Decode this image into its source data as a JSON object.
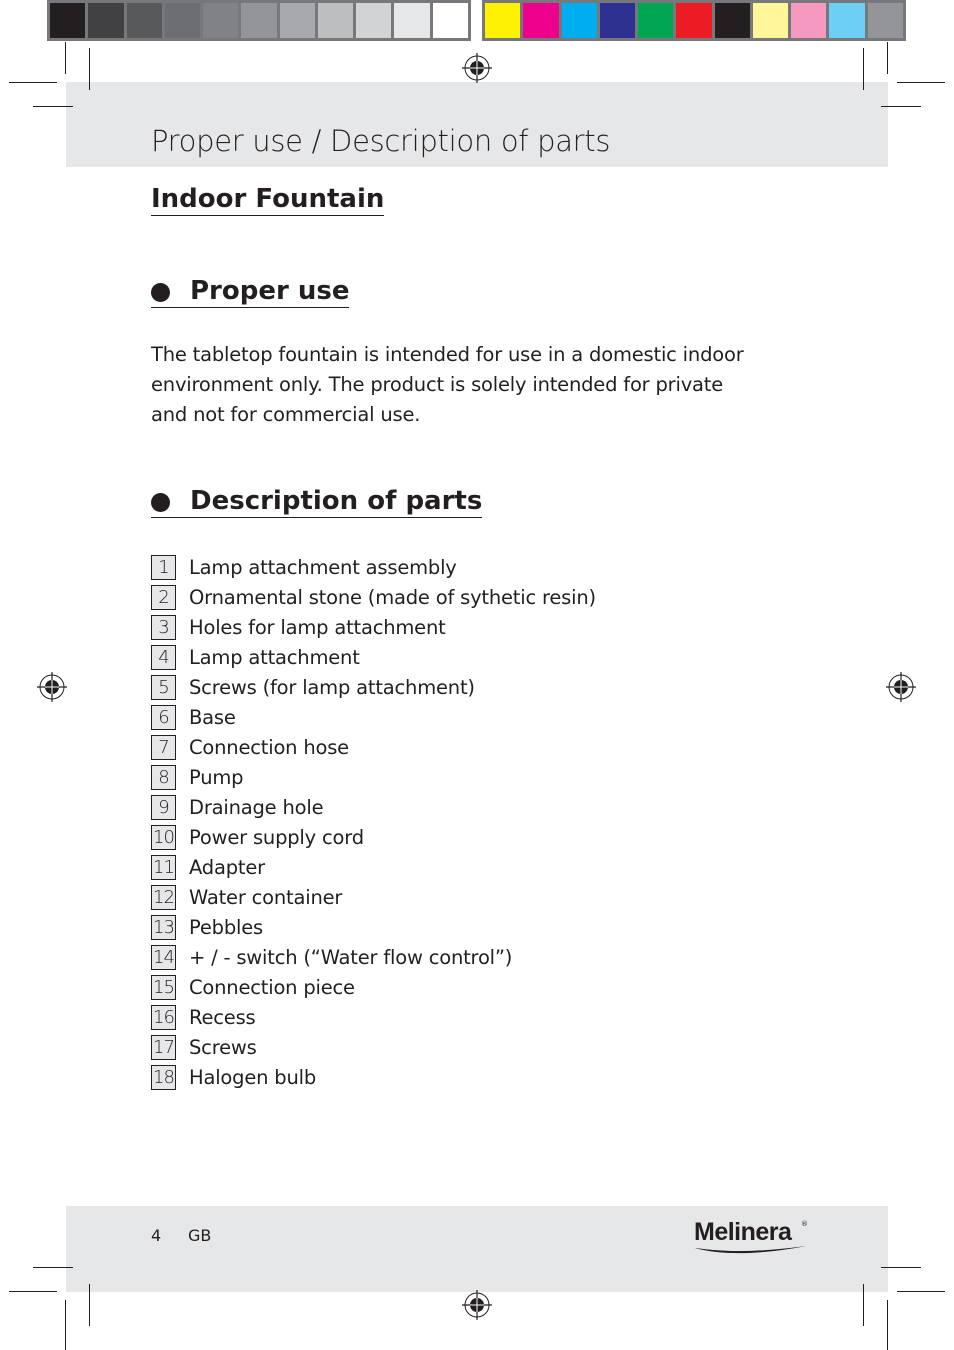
{
  "print_marks": {
    "gray_swatches": [
      "#231f20",
      "#414042",
      "#58595b",
      "#6d6e71",
      "#808285",
      "#939598",
      "#a7a9ac",
      "#bcbec0",
      "#d1d3d4",
      "#e6e7e8",
      "#ffffff"
    ],
    "color_swatches": [
      "#fff200",
      "#ec008c",
      "#00aeef",
      "#2e3192",
      "#00a651",
      "#ed1c24",
      "#231f20",
      "#fff799",
      "#f49ac1",
      "#6dcff6",
      "#939598"
    ]
  },
  "header": {
    "title": "Proper use / Description of parts"
  },
  "document": {
    "product_title": "Indoor Fountain",
    "sections": [
      {
        "heading": "Proper use",
        "body": "The tabletop fountain is intended for use in a domestic indoor environment only. The product is solely intended for private and not for commercial use."
      },
      {
        "heading": "Description of parts"
      }
    ],
    "parts": [
      {
        "number": "1",
        "label": "Lamp attachment assembly"
      },
      {
        "number": "2",
        "label": "Ornamental stone (made of sythetic resin)"
      },
      {
        "number": "3",
        "label": "Holes for lamp attachment"
      },
      {
        "number": "4",
        "label": "Lamp attachment"
      },
      {
        "number": "5",
        "label": "Screws (for lamp attachment)"
      },
      {
        "number": "6",
        "label": "Base"
      },
      {
        "number": "7",
        "label": "Connection hose"
      },
      {
        "number": "8",
        "label": "Pump"
      },
      {
        "number": "9",
        "label": "Drainage hole"
      },
      {
        "number": "10",
        "label": "Power supply cord"
      },
      {
        "number": "11",
        "label": "Adapter"
      },
      {
        "number": "12",
        "label": "Water container"
      },
      {
        "number": "13",
        "label": "Pebbles"
      },
      {
        "number": "14",
        "label": "+ / - switch (“Water flow control”)"
      },
      {
        "number": "15",
        "label": "Connection piece"
      },
      {
        "number": "16",
        "label": "Recess"
      },
      {
        "number": "17",
        "label": "Screws"
      },
      {
        "number": "18",
        "label": "Halogen bulb"
      }
    ]
  },
  "footer": {
    "page_number": "4",
    "language": "GB",
    "brand": "Melinera",
    "brand_mark": "®"
  }
}
